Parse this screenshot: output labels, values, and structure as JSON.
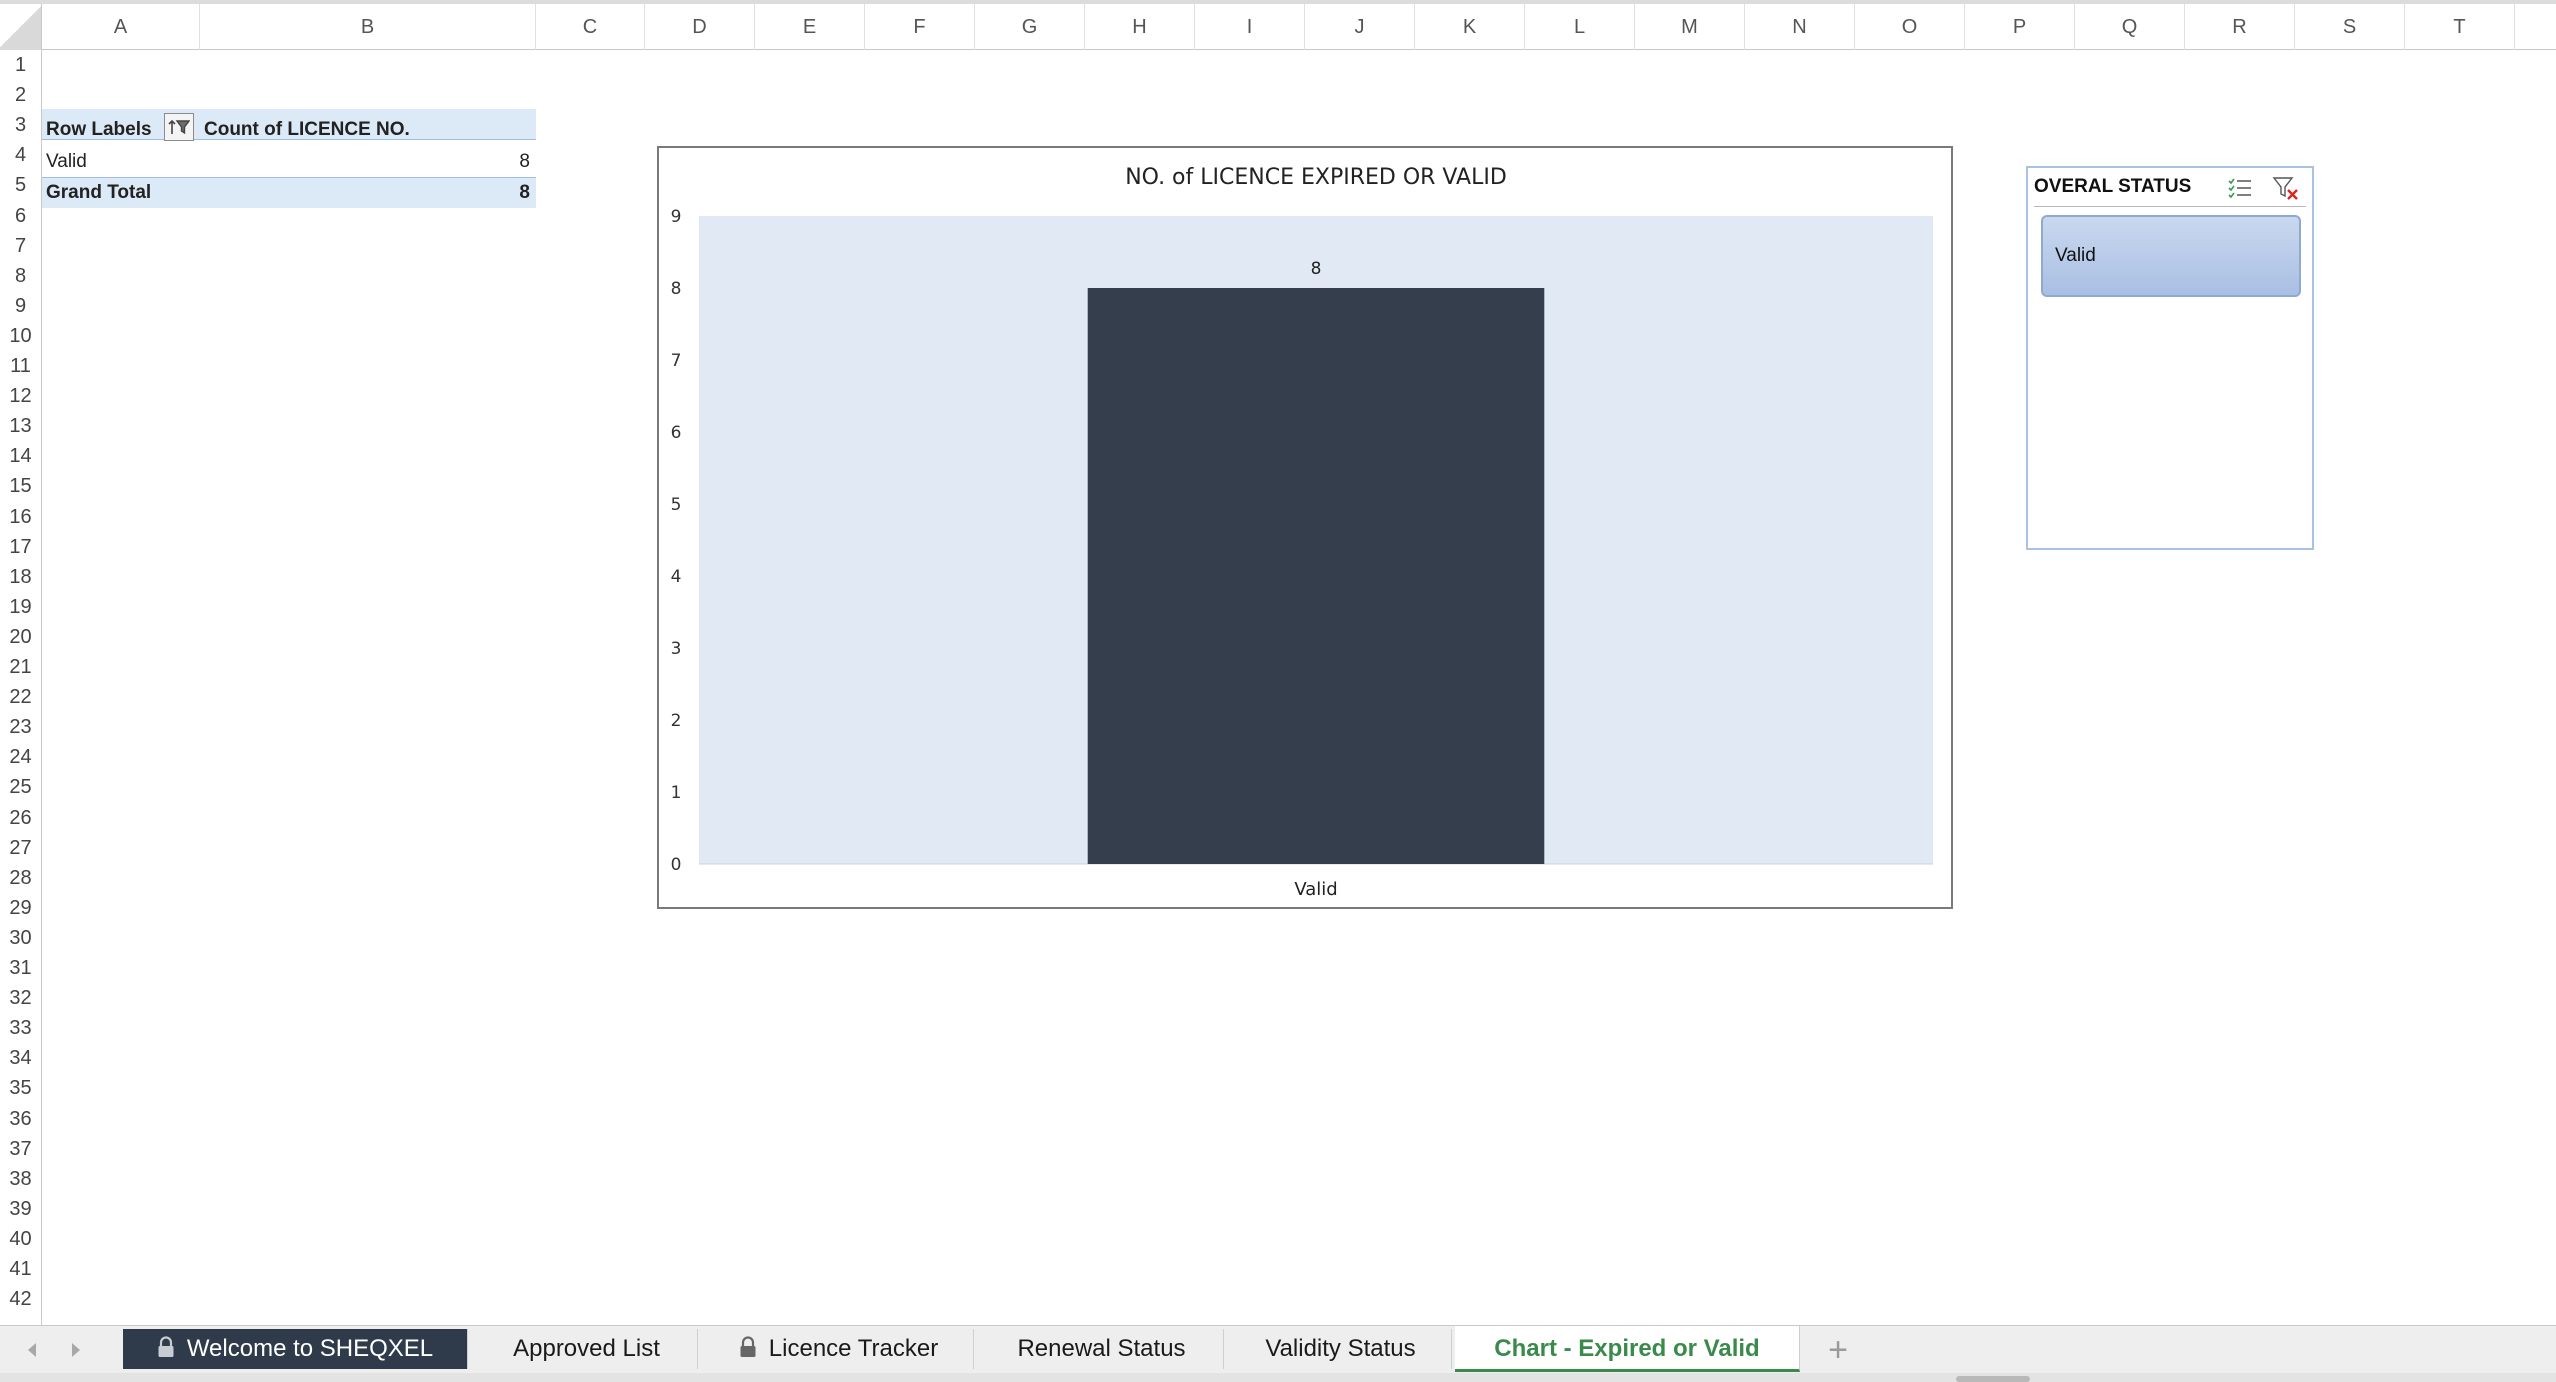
{
  "grid": {
    "columns": [
      "A",
      "B",
      "C",
      "D",
      "E",
      "F",
      "G",
      "H",
      "I",
      "J",
      "K",
      "L",
      "M",
      "N",
      "O",
      "P",
      "Q",
      "R",
      "S",
      "T"
    ],
    "rows": [
      1,
      2,
      3,
      4,
      5,
      6,
      7,
      8,
      9,
      10,
      11,
      12,
      13,
      14,
      15,
      16,
      17,
      18,
      19,
      20,
      21,
      22,
      23,
      24,
      25,
      26,
      27,
      28,
      29,
      30,
      31,
      32,
      33,
      34,
      35,
      36,
      37,
      38,
      39,
      40,
      41,
      42
    ]
  },
  "pivot": {
    "row_labels": "Row Labels",
    "count_header": "Count of LICENCE NO.",
    "rows": [
      {
        "label": "Valid",
        "value": "8"
      }
    ],
    "grand_total_label": "Grand Total",
    "grand_total_value": "8"
  },
  "chart_data": {
    "type": "bar",
    "title": "NO. of LICENCE EXPIRED OR VALID",
    "categories": [
      "Valid"
    ],
    "values": [
      8
    ],
    "data_labels": [
      "8"
    ],
    "ylim": [
      0,
      9
    ],
    "yticks": [
      "0",
      "1",
      "2",
      "3",
      "4",
      "5",
      "6",
      "7",
      "8",
      "9"
    ],
    "xlabel": "",
    "ylabel": "",
    "grid": false,
    "legend": "none",
    "bar_color": "#353e4c",
    "plot_background": "#e1eaf4"
  },
  "slicer": {
    "title": "OVERAL STATUS",
    "items": [
      "Valid"
    ],
    "multi_select_icon": "multi-select-icon",
    "clear_filter_icon": "clear-filter-icon"
  },
  "tabs": {
    "items": [
      {
        "label": "Welcome to SHEQXEL",
        "locked": true
      },
      {
        "label": "Approved List",
        "locked": false
      },
      {
        "label": "Licence Tracker",
        "locked": true
      },
      {
        "label": "Renewal Status",
        "locked": false
      },
      {
        "label": "Validity Status",
        "locked": false
      },
      {
        "label": "Chart - Expired or Valid",
        "locked": false
      }
    ],
    "add_label": "+"
  },
  "colors": {
    "accent_green": "#3a8a4c",
    "dark_tab": "#2f3a4a",
    "pivot_band": "#dce9f7"
  }
}
